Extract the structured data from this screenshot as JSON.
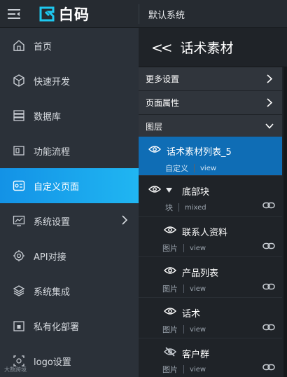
{
  "header": {
    "brand": "白码",
    "system_name": "默认系统",
    "colors": {
      "brand_accent": "#1ec8f0",
      "active_gradient_start": "#1392e6",
      "active_gradient_end": "#20b6f2",
      "selected_row": "#0f6db5"
    }
  },
  "sidebar": {
    "items": [
      {
        "label": "首页",
        "icon": "home-icon"
      },
      {
        "label": "快速开发",
        "icon": "cube-icon"
      },
      {
        "label": "数据库",
        "icon": "database-icon"
      },
      {
        "label": "功能流程",
        "icon": "flow-icon"
      },
      {
        "label": "自定义页面",
        "icon": "custom-page-icon",
        "active": true
      },
      {
        "label": "系统设置",
        "icon": "chart-settings-icon",
        "has_submenu": true
      },
      {
        "label": "API对接",
        "icon": "api-icon"
      },
      {
        "label": "系统集成",
        "icon": "layers-icon"
      },
      {
        "label": "私有化部署",
        "icon": "lock-icon"
      },
      {
        "label": "logo设置",
        "icon": "logo-icon"
      }
    ]
  },
  "panel": {
    "back_symbol": "<<",
    "title": "话术素材",
    "sections": {
      "more_settings": "更多设置",
      "page_props": "页面属性",
      "layers": "图层"
    },
    "layers": [
      {
        "name": "话术素材列表_5",
        "type": "自定义",
        "sub": "view",
        "selected": true,
        "visible": true
      },
      {
        "name": "底部块",
        "type": "块",
        "sub": "mixed",
        "visible": true,
        "expanded": true,
        "link": true
      },
      {
        "name": "联系人资料",
        "type": "图片",
        "sub": "view",
        "visible": true,
        "link": true
      },
      {
        "name": "产品列表",
        "type": "图片",
        "sub": "view",
        "visible": true,
        "link": true
      },
      {
        "name": "话术",
        "type": "图片",
        "sub": "view",
        "visible": true,
        "link": true
      },
      {
        "name": "客户群",
        "type": "图片",
        "sub": "view",
        "visible": false,
        "link": true
      }
    ]
  },
  "watermark": "大数跨境"
}
